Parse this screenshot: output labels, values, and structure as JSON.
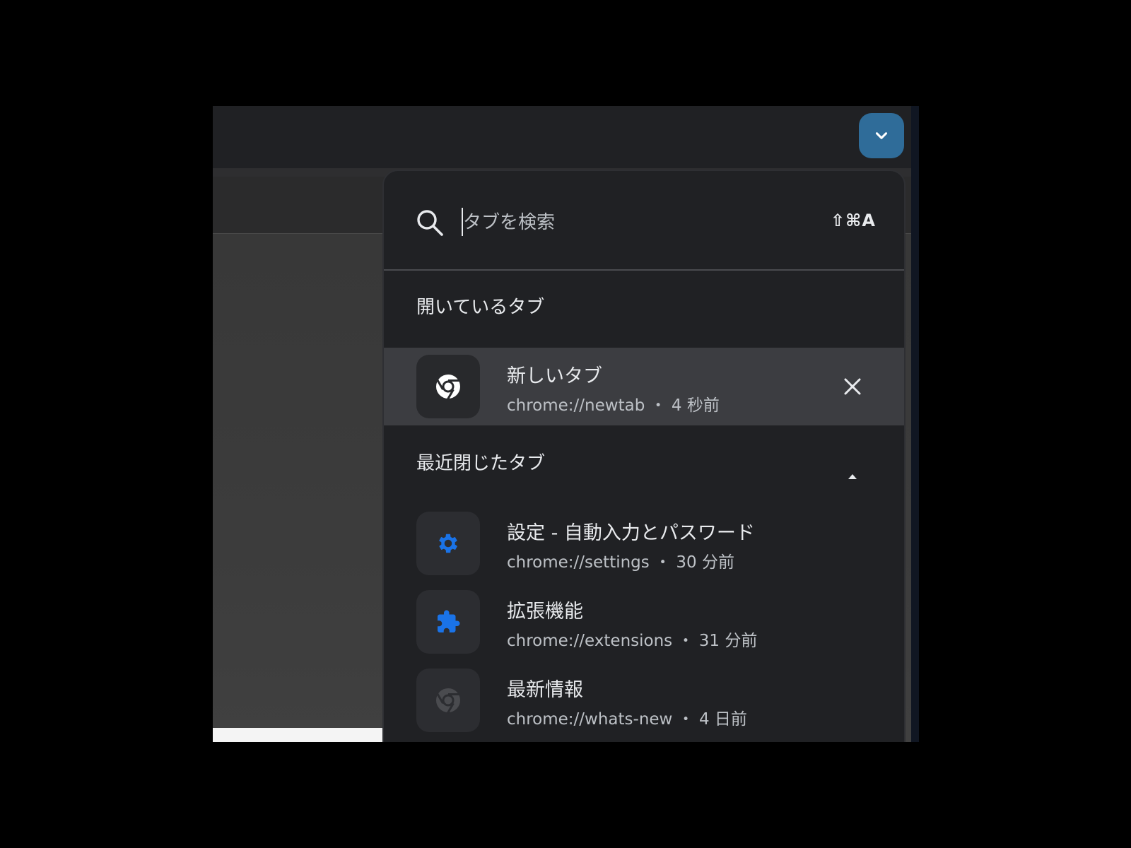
{
  "search": {
    "placeholder": "タブを検索",
    "shortcut": "⇧⌘A"
  },
  "open_tabs": {
    "heading": "開いているタブ",
    "items": [
      {
        "title": "新しいタブ",
        "subtitle": "chrome://newtab ・ 4 秒前",
        "icon": "chrome-icon"
      }
    ]
  },
  "recently_closed": {
    "heading": "最近閉じたタブ",
    "items": [
      {
        "title": "設定 - 自動入力とパスワード",
        "subtitle": "chrome://settings ・ 30 分前",
        "icon": "gear-icon"
      },
      {
        "title": "拡張機能",
        "subtitle": "chrome://extensions ・ 31 分前",
        "icon": "puzzle-icon"
      },
      {
        "title": "最新情報",
        "subtitle": "chrome://whats-new ・ 4 日前",
        "icon": "chrome-icon"
      }
    ]
  },
  "colors": {
    "panel_bg": "#202124",
    "active_row": "#3c3d41",
    "accent_blue": "#1a73e8",
    "dropdown_button": "#2f6c99"
  }
}
